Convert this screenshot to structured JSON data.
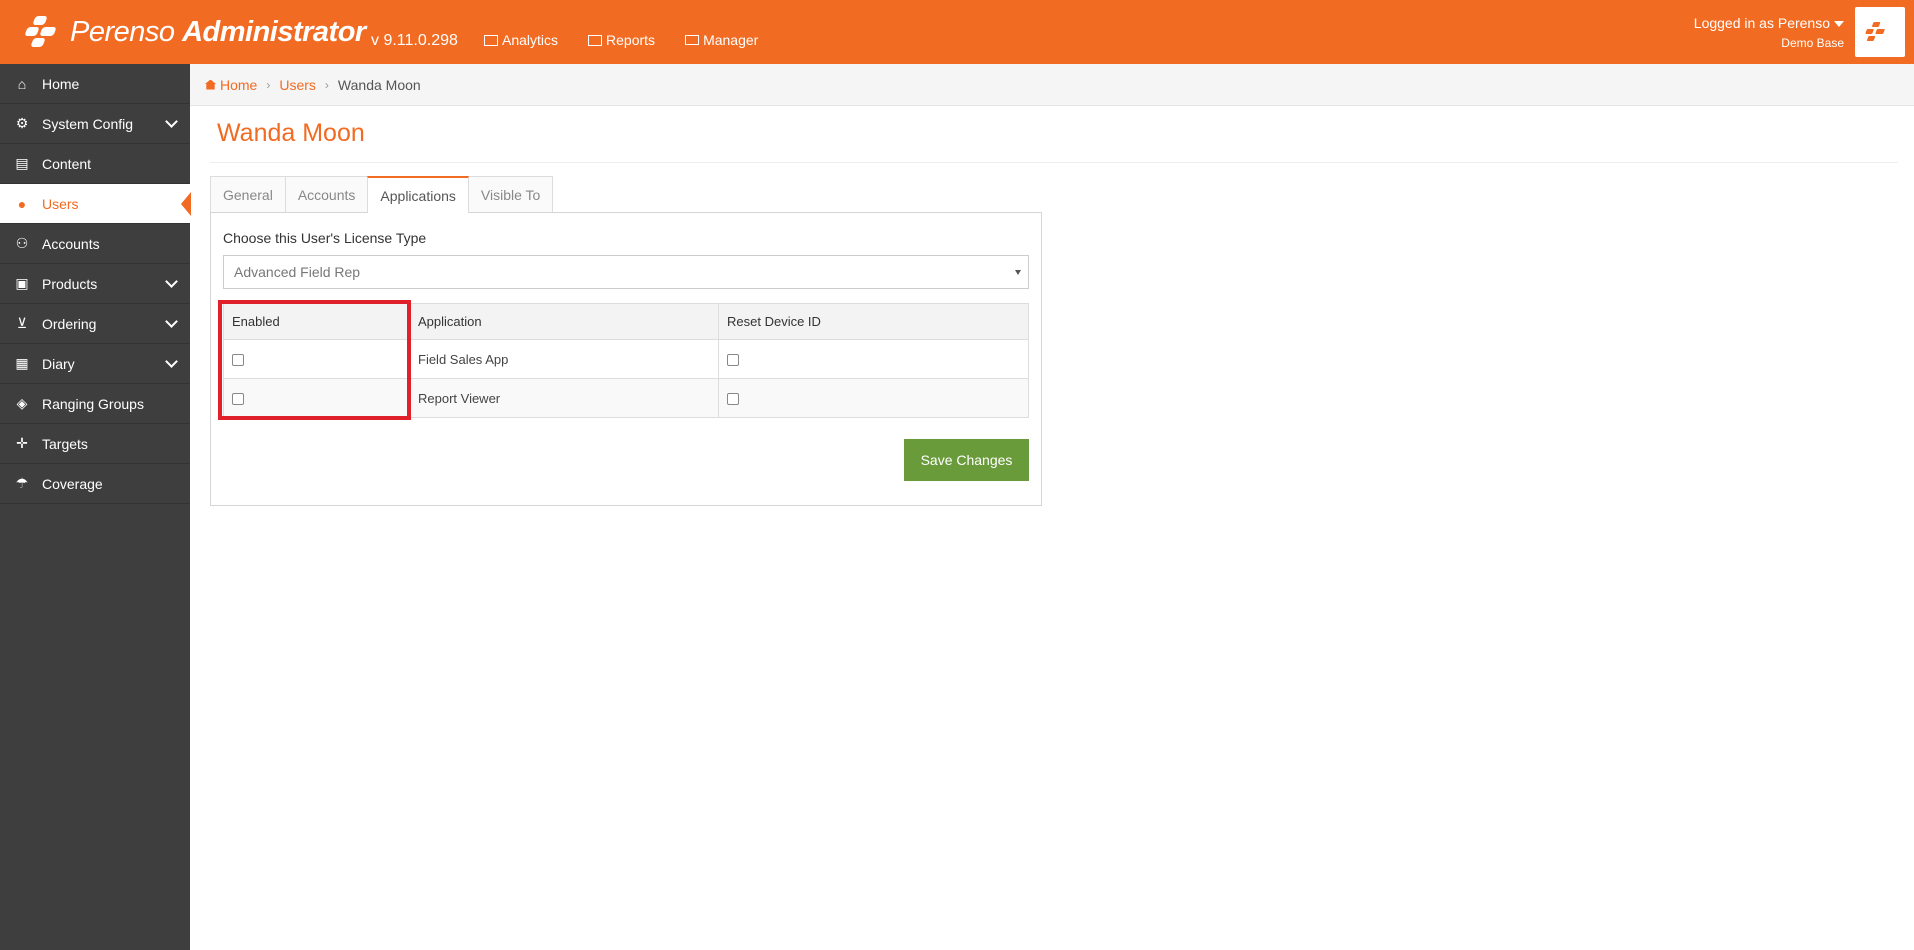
{
  "header": {
    "brand_light": "Perenso",
    "brand_bold": "Administrator",
    "version": "v 9.11.0.298",
    "nav": [
      {
        "label": "Analytics",
        "icon": "chart-icon"
      },
      {
        "label": "Reports",
        "icon": "table-icon"
      },
      {
        "label": "Manager",
        "icon": "briefcase-icon"
      }
    ],
    "user_label": "Logged in as Perenso",
    "database": "Demo Base"
  },
  "sidebar": {
    "items": [
      {
        "label": "Home",
        "icon": "home-icon",
        "expandable": false,
        "active": false
      },
      {
        "label": "System Config",
        "icon": "gear-icon",
        "expandable": true,
        "active": false
      },
      {
        "label": "Content",
        "icon": "file-icon",
        "expandable": false,
        "active": false
      },
      {
        "label": "Users",
        "icon": "user-icon",
        "expandable": false,
        "active": true
      },
      {
        "label": "Accounts",
        "icon": "users-icon",
        "expandable": false,
        "active": false
      },
      {
        "label": "Products",
        "icon": "gift-icon",
        "expandable": true,
        "active": false
      },
      {
        "label": "Ordering",
        "icon": "cart-icon",
        "expandable": true,
        "active": false
      },
      {
        "label": "Diary",
        "icon": "calendar-icon",
        "expandable": true,
        "active": false
      },
      {
        "label": "Ranging Groups",
        "icon": "cubes-icon",
        "expandable": false,
        "active": false
      },
      {
        "label": "Targets",
        "icon": "crosshairs-icon",
        "expandable": false,
        "active": false
      },
      {
        "label": "Coverage",
        "icon": "umbrella-icon",
        "expandable": false,
        "active": false
      }
    ]
  },
  "breadcrumb": {
    "home": "Home",
    "users": "Users",
    "current": "Wanda Moon"
  },
  "page": {
    "title": "Wanda Moon",
    "tabs": [
      "General",
      "Accounts",
      "Applications",
      "Visible To"
    ],
    "active_tab": "Applications",
    "license_label": "Choose this User's License Type",
    "license_value": "Advanced Field Rep",
    "table": {
      "headers": [
        "Enabled",
        "Application",
        "Reset Device ID"
      ],
      "rows": [
        {
          "enabled": false,
          "application": "Field Sales App",
          "reset": false
        },
        {
          "enabled": false,
          "application": "Report Viewer",
          "reset": false
        }
      ]
    },
    "save_label": "Save Changes"
  },
  "colors": {
    "accent": "#f26b22",
    "sidebar": "#3e3e3e",
    "save_button": "#6a9b3a",
    "highlight": "#e0202a"
  }
}
